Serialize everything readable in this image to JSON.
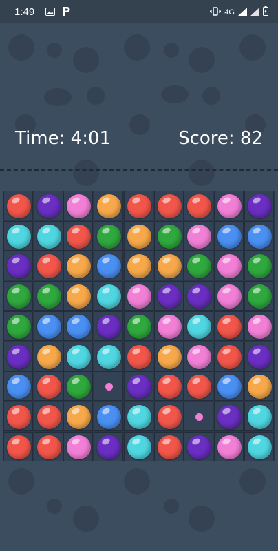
{
  "status_bar": {
    "time": "1:49",
    "network": "4G",
    "icons": [
      "image-icon",
      "p-app-icon",
      "vibrate-icon",
      "signal-icon",
      "battery-icon"
    ]
  },
  "game": {
    "time_label": "Time: 4:01",
    "score_label": "Score: 82"
  },
  "colors": {
    "R": "#f2564a",
    "P": "#6a2ec2",
    "K": "#f27fd6",
    "O": "#f7a84a",
    "C": "#4fd6e0",
    "G": "#2fa83d",
    "B": "#4a8ff2"
  },
  "board": {
    "rows": 9,
    "cols": 9,
    "grid": [
      [
        "R",
        "P",
        "K",
        "O",
        "R",
        "R",
        "R",
        "K",
        "P"
      ],
      [
        "C",
        "C",
        "R",
        "G",
        "O",
        "G",
        "K",
        "B",
        "B"
      ],
      [
        "P",
        "R",
        "O",
        "B",
        "O",
        "O",
        "G",
        "K",
        "G"
      ],
      [
        "G",
        "G",
        "O",
        "C",
        "K",
        "P",
        "P",
        "K",
        "G"
      ],
      [
        "G",
        "B",
        "B",
        "P",
        "G",
        "K",
        "C",
        "R",
        "K"
      ],
      [
        "P",
        "O",
        "C",
        "C",
        "R",
        "O",
        "K",
        "R",
        "P"
      ],
      [
        "B",
        "R",
        "G",
        "k",
        "P",
        "R",
        "R",
        "B",
        "O"
      ],
      [
        "R",
        "R",
        "O",
        "B",
        "C",
        "R",
        "k",
        "P",
        "C"
      ],
      [
        "R",
        "R",
        "K",
        "P",
        "C",
        "R",
        "P",
        "K",
        "C"
      ]
    ]
  }
}
